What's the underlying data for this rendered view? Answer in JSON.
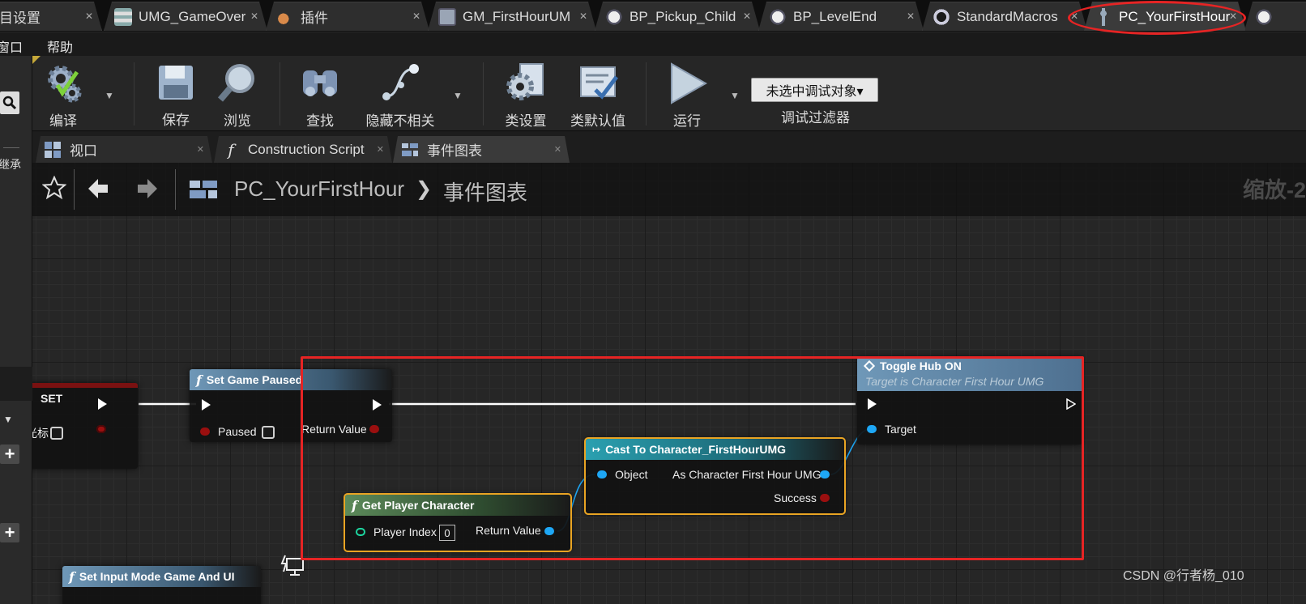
{
  "doc_tabs": [
    {
      "label": "目设置",
      "icon": "settings-icon"
    },
    {
      "label": "UMG_GameOver",
      "icon": "widget-blueprint-icon"
    },
    {
      "label": "插件",
      "icon": "plugin-icon"
    },
    {
      "label": "GM_FirstHourUM",
      "icon": "game-mode-icon"
    },
    {
      "label": "BP_Pickup_Child",
      "icon": "blueprint-icon"
    },
    {
      "label": "BP_LevelEnd",
      "icon": "blueprint-icon"
    },
    {
      "label": "StandardMacros",
      "icon": "macro-library-icon"
    },
    {
      "label": "PC_YourFirstHour",
      "icon": "player-controller-icon"
    }
  ],
  "menu": {
    "window": "窗口",
    "help": "帮助"
  },
  "left_panel": {
    "label_top": "继承",
    "pin_label": "标光标"
  },
  "toolbar": {
    "compile": "编译",
    "save": "保存",
    "browse": "浏览",
    "find": "查找",
    "hide_unrelated": "隐藏不相关",
    "class_settings": "类设置",
    "class_defaults": "类默认值",
    "play": "运行",
    "debug_object": "未选中调试对象▾",
    "debug_filter": "调试过滤器"
  },
  "sub_tabs": [
    {
      "label": "视口",
      "icon": "viewport-icon"
    },
    {
      "label": "Construction Script",
      "icon": "function-icon"
    },
    {
      "label": "事件图表",
      "icon": "event-graph-icon"
    }
  ],
  "breadcrumb": {
    "root": "PC_YourFirstHour",
    "separator": "❯",
    "leaf": "事件图表",
    "zoom": "缩放-2"
  },
  "nodes": {
    "set": {
      "title": "SET"
    },
    "set_game_paused": {
      "title": "Set Game Paused",
      "in_paused": "Paused",
      "out_return": "Return Value"
    },
    "toggle_hub": {
      "title": "Toggle Hub ON",
      "subtitle": "Target is Character First Hour UMG",
      "in_target": "Target"
    },
    "cast": {
      "title": "Cast To Character_FirstHourUMG",
      "in_object": "Object",
      "out_as": "As Character First Hour UMG",
      "out_success": "Success"
    },
    "get_player_character": {
      "title": "Get Player Character",
      "in_index": "Player Index",
      "index_value": "0",
      "out_return": "Return Value"
    },
    "set_input_mode": {
      "title": "Set Input Mode Game And UI"
    }
  },
  "colors": {
    "exec_wire": "#ffffff",
    "object_pin": "#1ea7f5",
    "bool_pin": "#9a0f0f",
    "int_pin": "#1dd6a0",
    "function_header": "#6f98b8",
    "pure_header": "#5c8a5a",
    "cast_header": "#2aa0b0",
    "annotation": "#e62424"
  },
  "watermark": "CSDN @行者杨_010"
}
